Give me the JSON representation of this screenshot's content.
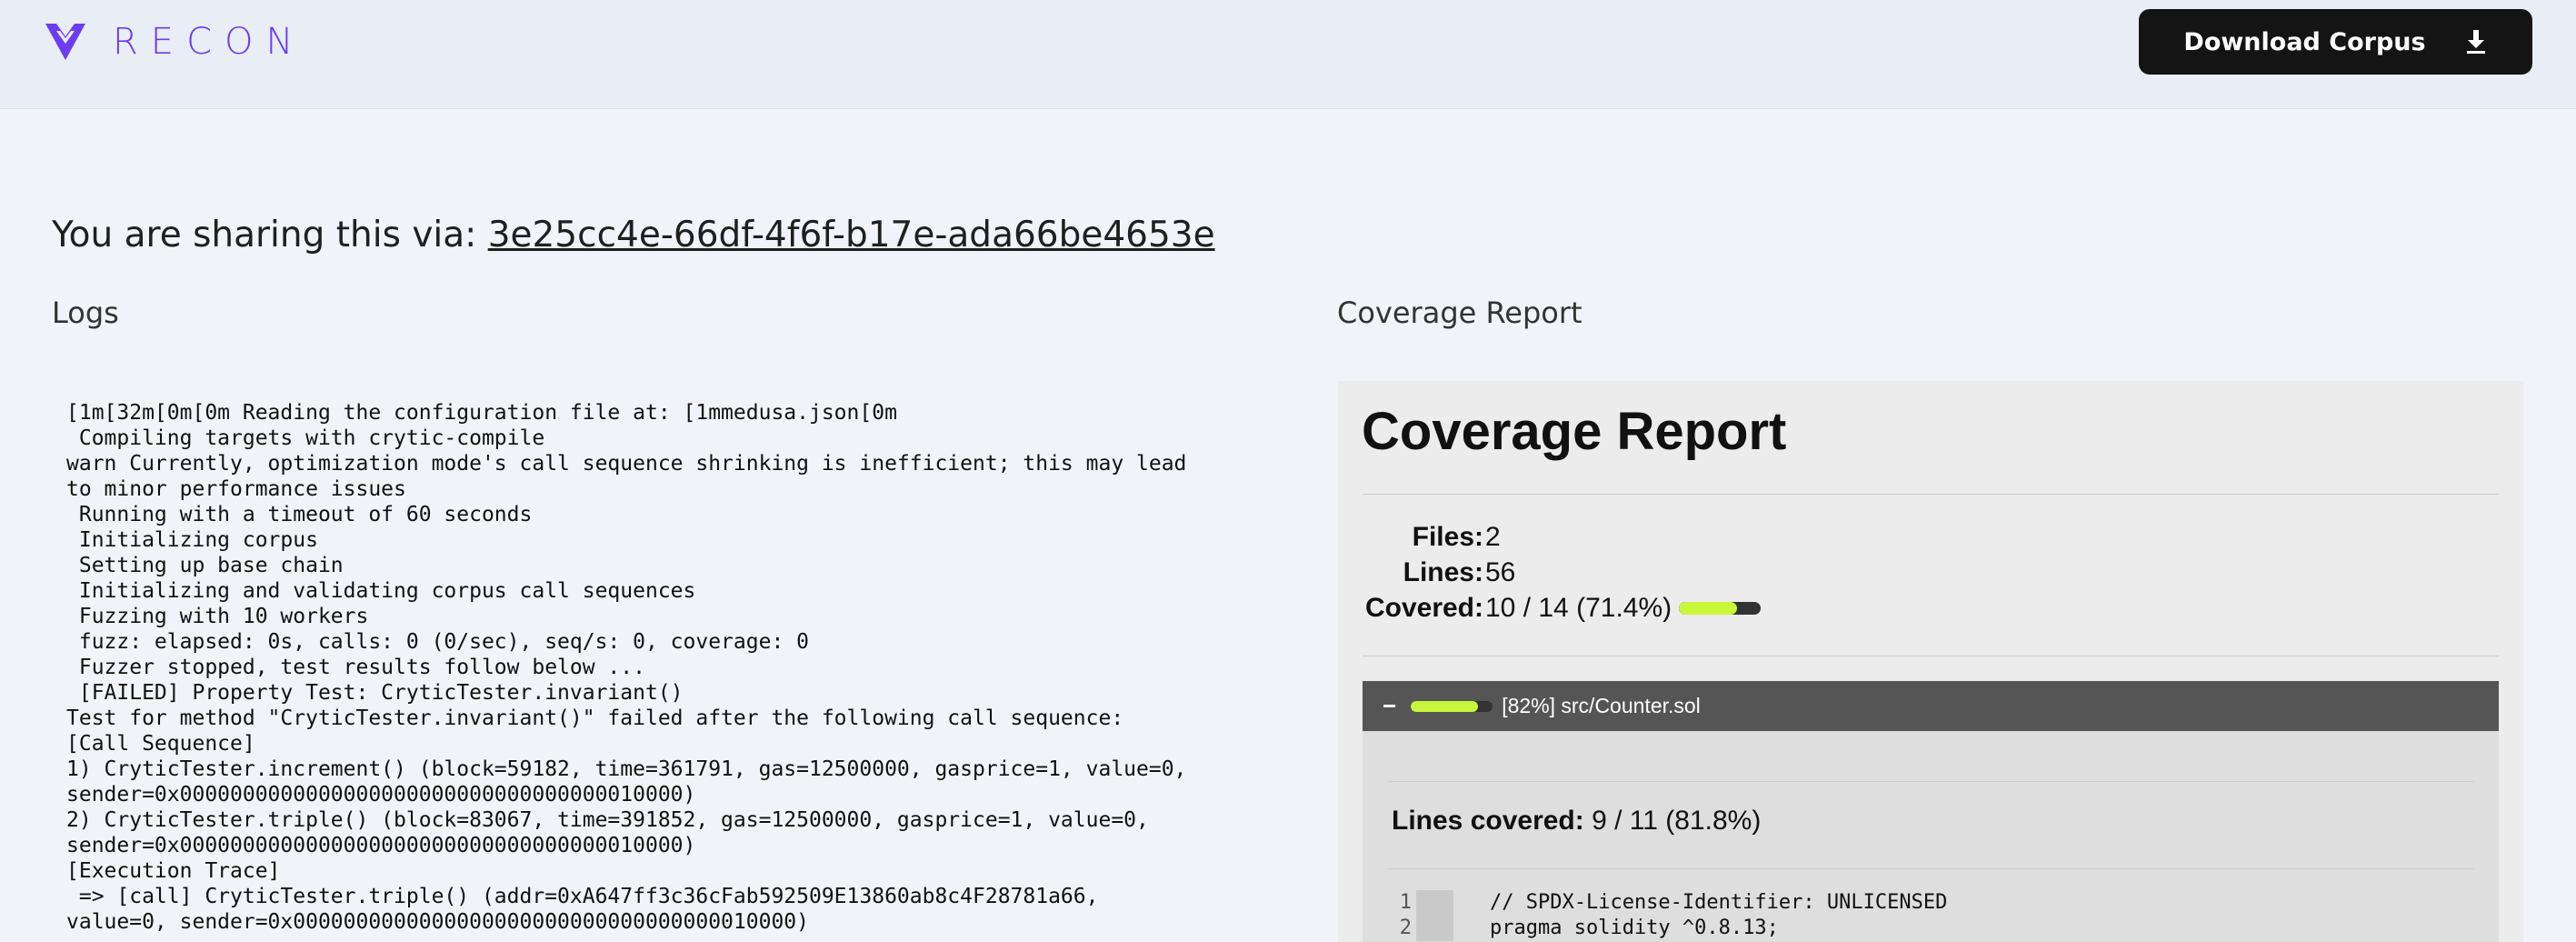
{
  "header": {
    "brand": "RECON",
    "download_label": "Download Corpus"
  },
  "share": {
    "prefix": "You are sharing this via:",
    "link": "3e25cc4e-66df-4f6f-b17e-ada66be4653e"
  },
  "sections": {
    "logs_title": "Logs",
    "coverage_title": "Coverage Report"
  },
  "logs": [
    "[1m[32m[0m[0m Reading the configuration file at: [1mmedusa.json[0m",
    " Compiling targets with crytic-compile",
    "warn Currently, optimization mode's call sequence shrinking is inefficient; this may lead",
    "to minor performance issues",
    " Running with a timeout of 60 seconds",
    " Initializing corpus",
    " Setting up base chain",
    " Initializing and validating corpus call sequences",
    " Fuzzing with 10 workers",
    " fuzz: elapsed: 0s, calls: 0 (0/sec), seq/s: 0, coverage: 0",
    " Fuzzer stopped, test results follow below ...",
    " [FAILED] Property Test: CryticTester.invariant()",
    "Test for method \"CryticTester.invariant()\" failed after the following call sequence:",
    "[Call Sequence]",
    "1) CryticTester.increment() (block=59182, time=361791, gas=12500000, gasprice=1, value=0,",
    "sender=0x0000000000000000000000000000000000010000)",
    "2) CryticTester.triple() (block=83067, time=391852, gas=12500000, gasprice=1, value=0,",
    "sender=0x0000000000000000000000000000000000010000)",
    "[Execution Trace]",
    " => [call] CryticTester.triple() (addr=0xA647ff3c36cFab592509E13860ab8c4F28781a66,",
    "value=0, sender=0x0000000000000000000000000000000000010000)"
  ],
  "coverage": {
    "heading": "Coverage Report",
    "stats": [
      {
        "label": "Files:",
        "value": "2"
      },
      {
        "label": "Lines:",
        "value": "56"
      },
      {
        "label": "Covered:",
        "value": "10 / 14 (71.4%)",
        "progress": 0.714
      }
    ],
    "file": {
      "toggle": "−",
      "name": "[82%] src/Counter.sol",
      "progress": 0.82,
      "lines_covered_label": "Lines covered:",
      "lines_covered_value": "9 / 11 (81.8%)",
      "code": [
        {
          "n": "1",
          "text": "// SPDX-License-Identifier: UNLICENSED"
        },
        {
          "n": "2",
          "text": "pragma solidity ^0.8.13;"
        }
      ]
    }
  },
  "colors": {
    "brand": "#6b3cf0",
    "progress_fill": "#c8f73a",
    "progress_track": "#333333"
  }
}
